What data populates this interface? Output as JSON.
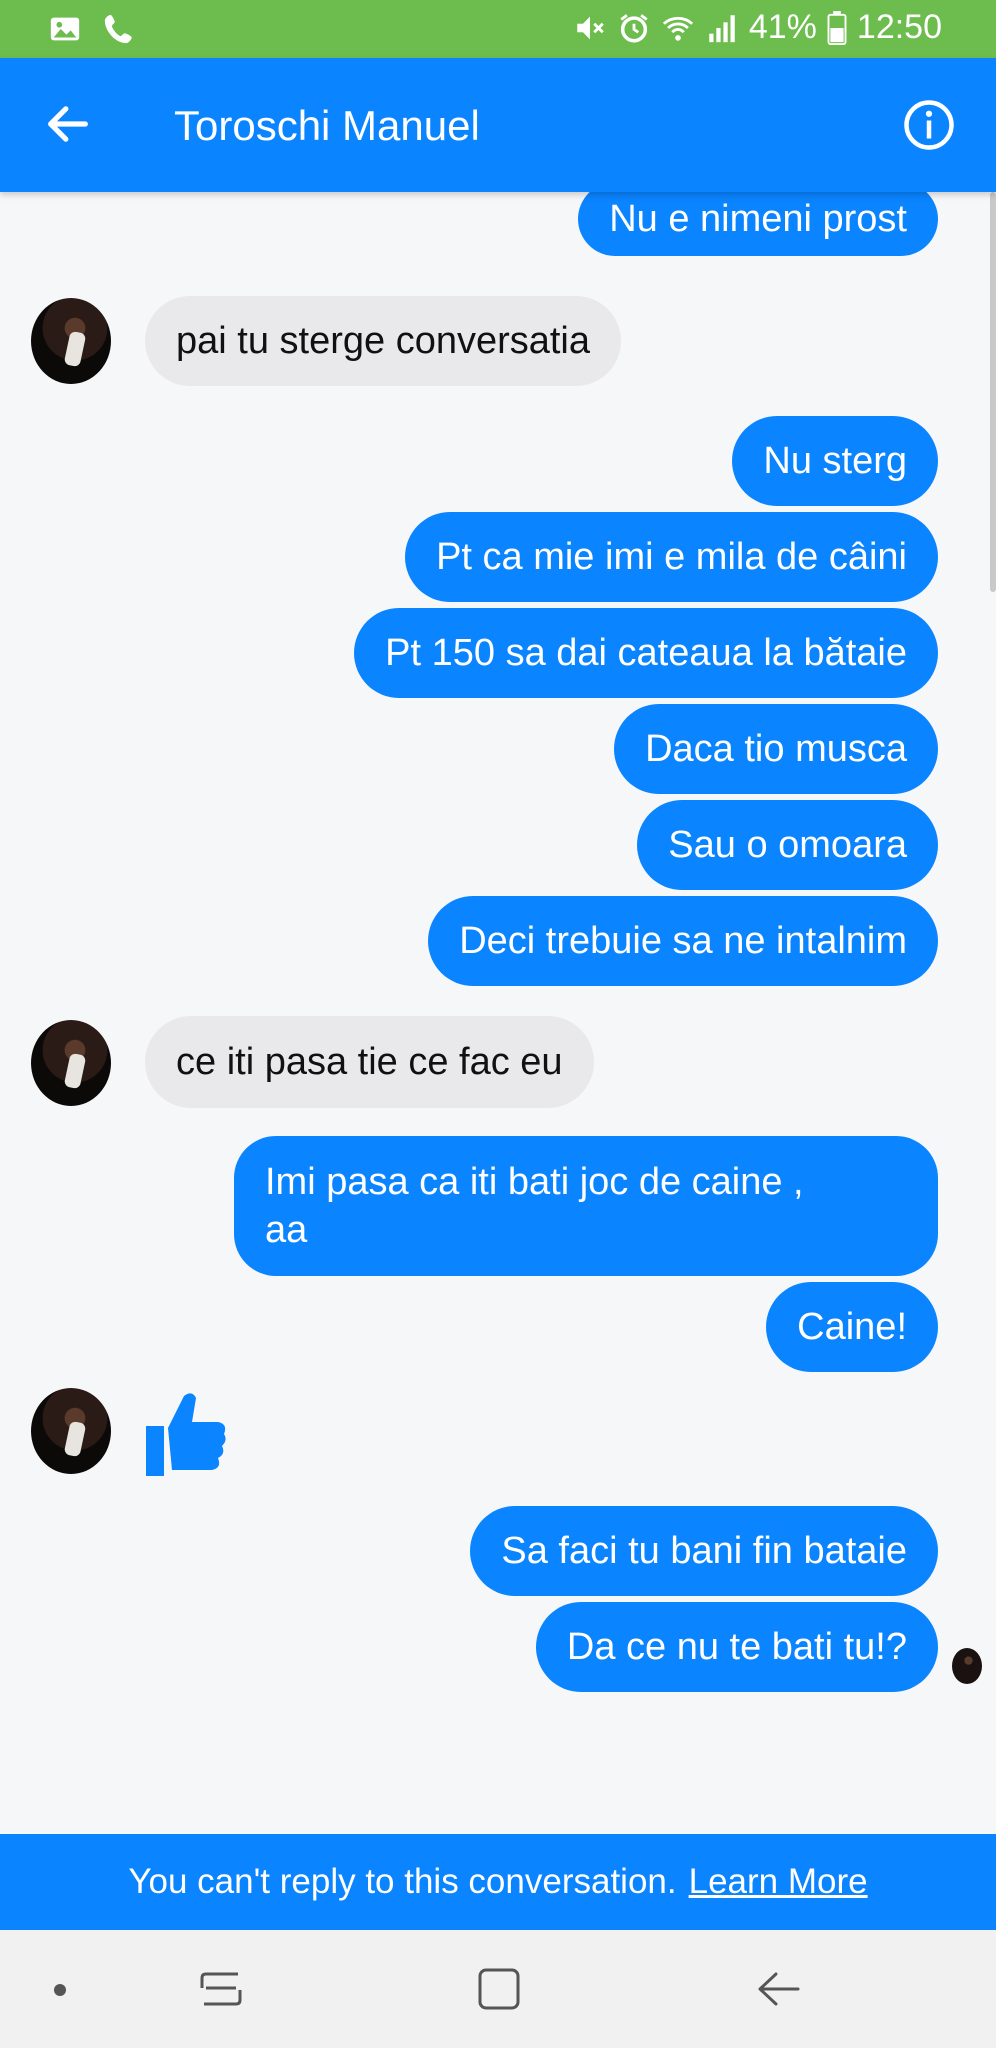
{
  "status_bar": {
    "left_icons": [
      "image-icon",
      "phone-icon"
    ],
    "right_icons": [
      "mute-icon",
      "alarm-icon",
      "wifi-icon",
      "signal-icon"
    ],
    "battery_label": "41%",
    "time": "12:50"
  },
  "header": {
    "contact_name": "Toroschi Manuel",
    "back_icon": "arrow-left-icon",
    "info_icon": "info-icon"
  },
  "messages": [
    {
      "from": "me",
      "text": "Nu e nimeni prost"
    },
    {
      "from": "them",
      "text": "pai tu sterge conversatia"
    },
    {
      "from": "me",
      "text": "Nu sterg"
    },
    {
      "from": "me",
      "text": "Pt ca mie imi e mila de câini"
    },
    {
      "from": "me",
      "text": "Pt 150 sa dai cateaua la bătaie"
    },
    {
      "from": "me",
      "text": "Daca tio musca"
    },
    {
      "from": "me",
      "text": "Sau o omoara"
    },
    {
      "from": "me",
      "text": "Deci trebuie sa ne intalnim"
    },
    {
      "from": "them",
      "text": "ce iti pasa tie ce fac eu"
    },
    {
      "from": "me",
      "text": "Imi pasa ca iti bati joc de caine ,",
      "text2": "aa"
    },
    {
      "from": "me",
      "text": "Caine!"
    },
    {
      "from": "them",
      "type": "like",
      "icon": "thumbs-up-icon"
    },
    {
      "from": "me",
      "text": "Sa faci tu bani fin bataie"
    },
    {
      "from": "me",
      "text": "Da ce nu te bati tu!?"
    }
  ],
  "banner": {
    "text": "You can't reply to this conversation.",
    "link": "Learn More"
  },
  "nav_bar": {
    "icons": [
      "dot-icon",
      "recents-icon",
      "home-icon",
      "back-nav-icon"
    ]
  },
  "colors": {
    "accent": "#0a84ff",
    "status_bar": "#6cbd4d",
    "incoming_bubble": "#e9e9eb"
  }
}
